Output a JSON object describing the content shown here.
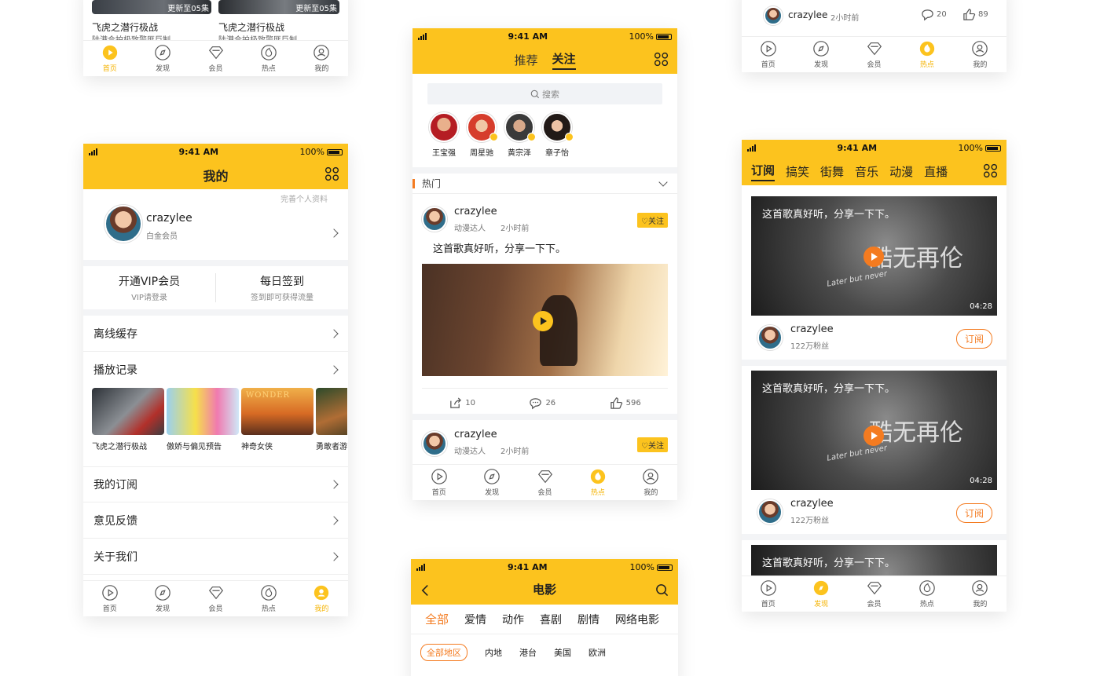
{
  "status": {
    "time": "9:41 AM",
    "battery": "100%"
  },
  "tabs": [
    "首页",
    "发现",
    "会员",
    "热点",
    "我的"
  ],
  "p1": {
    "badges": [
      "更新至05集",
      "更新至05集"
    ],
    "titles": [
      "飞虎之潜行极战",
      "飞虎之潜行极战"
    ],
    "subs": [
      "陆港合拍极致警匪巨制",
      "陆港合拍极致警匪巨制"
    ]
  },
  "p2": {
    "title": "我的",
    "username": "crazylee",
    "level": "白金会员",
    "complete": "完善个人资料",
    "vip": {
      "title": "开通VIP会员",
      "sub": "VIP请登录"
    },
    "sign": {
      "title": "每日签到",
      "sub": "签到即可获得流量"
    },
    "menu_offline": "离线缓存",
    "menu_history": "播放记录",
    "history": [
      "飞虎之潜行极战",
      "傲娇与偏见预告",
      "神奇女侠",
      "勇敢者游戏"
    ],
    "wonder_text": "WONDER",
    "menu_more": [
      "我的订阅",
      "意见反馈",
      "关于我们"
    ]
  },
  "p3": {
    "tab_recommend": "推荐",
    "tab_follow": "关注",
    "search_placeholder": "搜索",
    "people": [
      "王宝强",
      "周星驰",
      "黄宗泽",
      "章子怡"
    ],
    "section": "热门",
    "post": {
      "user": "crazylee",
      "role": "动漫达人",
      "time": "2小时前",
      "follow": "关注",
      "text": "这首歌真好听，分享一下下。",
      "shares": "10",
      "comments": "26",
      "likes": "596"
    },
    "post2": {
      "user": "crazylee",
      "role": "动漫达人",
      "time": "2小时前",
      "follow": "关注"
    }
  },
  "p4": {
    "title": "电影",
    "categories": [
      "全部",
      "爱情",
      "动作",
      "喜剧",
      "剧情",
      "网络电影"
    ],
    "regions": [
      "全部地区",
      "内地",
      "港台",
      "美国",
      "欧洲"
    ]
  },
  "p5": {
    "user": "crazylee",
    "time": "2小时前",
    "comments": "20",
    "likes": "89"
  },
  "p6": {
    "tabs": [
      "订阅",
      "搞笑",
      "街舞",
      "音乐",
      "动漫",
      "直播"
    ],
    "caption": "这首歌真好听，分享一下下。",
    "duration": "04:28",
    "poster_text": "酷无再伦",
    "poster_sub": "Later but never",
    "user": "crazylee",
    "fans": "122万粉丝",
    "subscribe": "订阅"
  },
  "colors": {
    "accent": "#fcc31e",
    "orange": "#f47b20"
  }
}
